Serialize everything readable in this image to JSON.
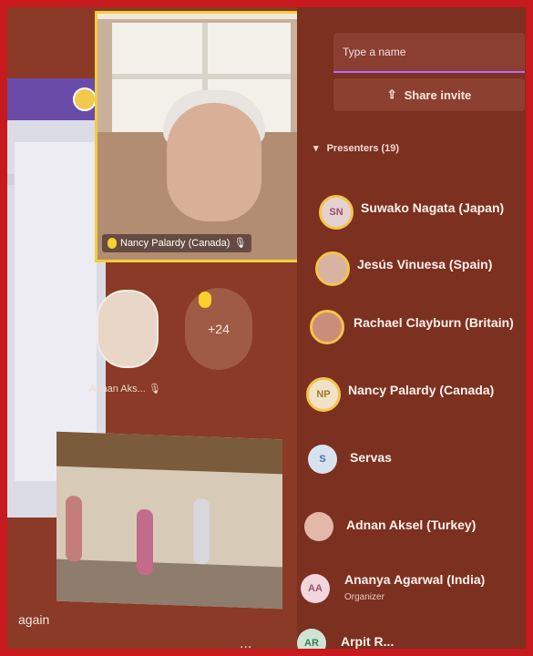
{
  "main": {
    "spotlight_name": "Nancy Palardy (Canada)",
    "tile_label": "Adnan Aks...",
    "more_count": "+24",
    "bottom_text": "again",
    "bottom_more": "..."
  },
  "panel": {
    "search_placeholder": "Type a name",
    "share_invite_label": "Share invite",
    "presenters_label": "Presenters (19)",
    "people": [
      {
        "initials": "SN",
        "name": "Suwako Nagata (Japan)"
      },
      {
        "initials": "",
        "name": "Jesús Vinuesa (Spain)"
      },
      {
        "initials": "",
        "name": "Rachael Clayburn (Britain)"
      },
      {
        "initials": "NP",
        "name": "Nancy Palardy (Canada)"
      },
      {
        "initials": "S",
        "name": "Servas"
      },
      {
        "initials": "",
        "name": "Adnan Aksel (Turkey)"
      },
      {
        "initials": "AA",
        "name": "Ananya Agarwal (India)",
        "role": "Organizer"
      },
      {
        "initials": "AR",
        "name": "Arpit R..."
      }
    ]
  },
  "colors": {
    "accent_purple": "#c06bff",
    "highlight_yellow": "#f0cf3b",
    "background_red": "#c8191e"
  }
}
